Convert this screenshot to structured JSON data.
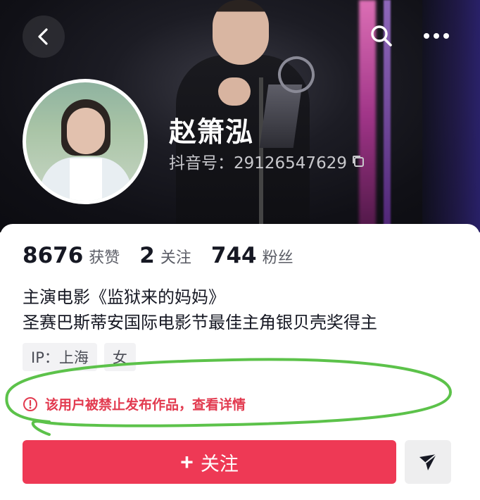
{
  "colors": {
    "accent": "#ee3955",
    "warning": "#e23a4f",
    "annotation_ring": "#5cc24a"
  },
  "header": {
    "back_icon": "chevron-left-icon",
    "search_icon": "search-icon",
    "more_icon": "more-horizontal-icon"
  },
  "profile": {
    "name": "赵箫泓",
    "douyin_id": "抖音号：29126547629",
    "copy_icon": "copy-icon"
  },
  "stats": [
    {
      "value": "8676",
      "label": "获赞"
    },
    {
      "value": "2",
      "label": "关注"
    },
    {
      "value": "744",
      "label": "粉丝"
    }
  ],
  "bio": {
    "line1": "主演电影《监狱来的妈妈》",
    "line2": "圣赛巴斯蒂安国际电影节最佳主角银贝壳奖得主"
  },
  "tags": [
    "IP：上海",
    "女"
  ],
  "notice": {
    "icon": "warning-circle-icon",
    "text": "该用户被禁止发布作品，查看详情"
  },
  "actions": {
    "follow_plus": "+",
    "follow_label": "关注",
    "share_icon": "send-icon"
  }
}
